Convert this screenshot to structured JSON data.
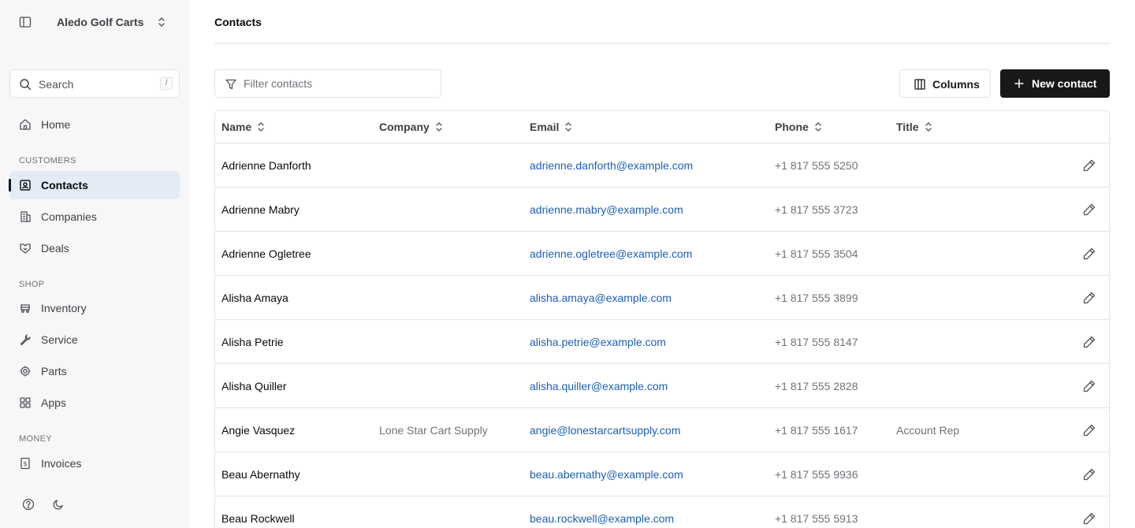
{
  "sidebar": {
    "org_name": "Aledo Golf Carts",
    "search": {
      "label": "Search",
      "shortcut": "/"
    },
    "items": [
      {
        "label": "Home",
        "icon": "home-icon"
      },
      {
        "label": "Contacts",
        "icon": "contact-card-icon",
        "active": true
      },
      {
        "label": "Companies",
        "icon": "building-icon"
      },
      {
        "label": "Deals",
        "icon": "handshake-icon"
      },
      {
        "label": "Inventory",
        "icon": "cart-icon"
      },
      {
        "label": "Service",
        "icon": "wrench-icon"
      },
      {
        "label": "Parts",
        "icon": "gear-icon"
      },
      {
        "label": "Apps",
        "icon": "grid-icon"
      },
      {
        "label": "Invoices",
        "icon": "invoice-icon"
      }
    ],
    "sections": [
      "CUSTOMERS",
      "SHOP",
      "MONEY"
    ],
    "footer_icons": [
      "help-icon",
      "moon-icon"
    ]
  },
  "page": {
    "title": "Contacts",
    "filter_placeholder": "Filter contacts",
    "columns_button": "Columns",
    "new_button": "New contact"
  },
  "table": {
    "headers": [
      "Name",
      "Company",
      "Email",
      "Phone",
      "Title"
    ],
    "rows": [
      {
        "name": "Adrienne Danforth",
        "company": "",
        "email": "adrienne.danforth@example.com",
        "phone": "+1 817 555 5250",
        "title": ""
      },
      {
        "name": "Adrienne Mabry",
        "company": "",
        "email": "adrienne.mabry@example.com",
        "phone": "+1 817 555 3723",
        "title": ""
      },
      {
        "name": "Adrienne Ogletree",
        "company": "",
        "email": "adrienne.ogletree@example.com",
        "phone": "+1 817 555 3504",
        "title": ""
      },
      {
        "name": "Alisha Amaya",
        "company": "",
        "email": "alisha.amaya@example.com",
        "phone": "+1 817 555 3899",
        "title": ""
      },
      {
        "name": "Alisha Petrie",
        "company": "",
        "email": "alisha.petrie@example.com",
        "phone": "+1 817 555 8147",
        "title": ""
      },
      {
        "name": "Alisha Quiller",
        "company": "",
        "email": "alisha.quiller@example.com",
        "phone": "+1 817 555 2828",
        "title": ""
      },
      {
        "name": "Angie Vasquez",
        "company": "Lone Star Cart Supply",
        "email": "angie@lonestarcartsupply.com",
        "phone": "+1 817 555 1617",
        "title": "Account Rep"
      },
      {
        "name": "Beau Abernathy",
        "company": "",
        "email": "beau.abernathy@example.com",
        "phone": "+1 817 555 9936",
        "title": ""
      },
      {
        "name": "Beau Rockwell",
        "company": "",
        "email": "beau.rockwell@example.com",
        "phone": "+1 817 555 5913",
        "title": ""
      }
    ]
  },
  "colors": {
    "accent": "#18181b",
    "link": "#1d5fb5",
    "active_bg": "#e3ebf5",
    "sidebar_bg": "#f7f7f8"
  }
}
